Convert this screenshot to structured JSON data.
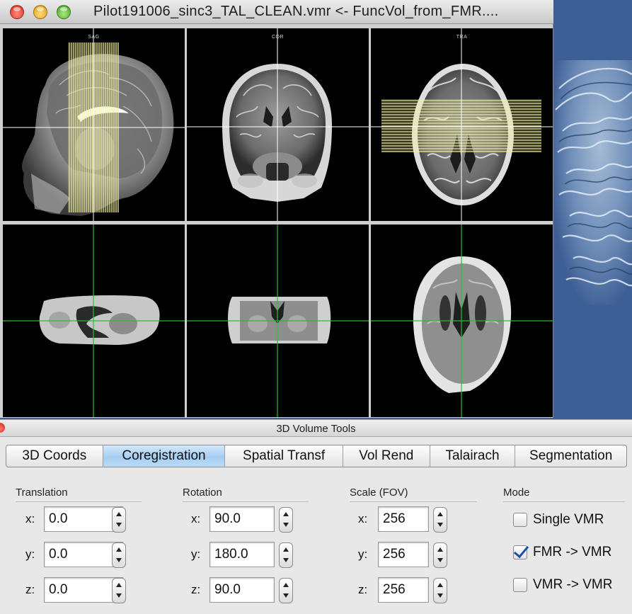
{
  "viewer": {
    "title": "Pilot191006_sinc3_TAL_CLEAN.vmr  <-  FuncVol_from_FMR....",
    "panes": [
      {
        "label": "SAG"
      },
      {
        "label": "COR"
      },
      {
        "label": "TRA"
      }
    ]
  },
  "tools": {
    "title": "3D Volume Tools",
    "tabs": [
      {
        "label": "3D Coords",
        "active": false
      },
      {
        "label": "Coregistration",
        "active": true
      },
      {
        "label": "Spatial Transf",
        "active": false
      },
      {
        "label": "Vol Rend",
        "active": false
      },
      {
        "label": "Talairach",
        "active": false
      },
      {
        "label": "Segmentation",
        "active": false
      }
    ],
    "translation": {
      "title": "Translation",
      "x_label": "x:",
      "x": "0.0",
      "y_label": "y:",
      "y": "0.0",
      "z_label": "z:",
      "z": "0.0"
    },
    "rotation": {
      "title": "Rotation",
      "x_label": "x:",
      "x": "90.0",
      "y_label": "y:",
      "y": "180.0",
      "z_label": "z:",
      "z": "90.0"
    },
    "scale": {
      "title": "Scale (FOV)",
      "x_label": "x:",
      "x": "256",
      "y_label": "y:",
      "y": "256",
      "z_label": "z:",
      "z": "256"
    },
    "mode": {
      "title": "Mode",
      "options": [
        {
          "label": "Single VMR",
          "checked": false
        },
        {
          "label": "FMR -> VMR",
          "checked": true
        },
        {
          "label": "VMR -> VMR",
          "checked": false
        }
      ]
    }
  },
  "colors": {
    "desktop": "#3e5f95",
    "crosshair_anatomical": "#ffffff",
    "crosshair_functional": "#22c22a",
    "slice_lines": "#f3f0a0",
    "active_tab": "#a6cdf1"
  }
}
